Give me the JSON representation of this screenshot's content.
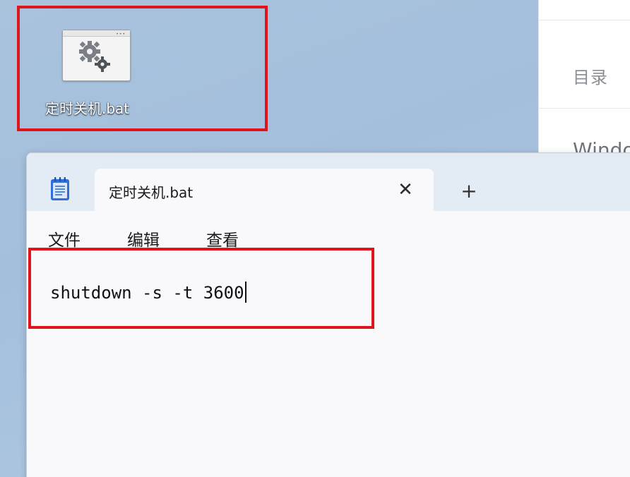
{
  "side_pane": {
    "toc_label": "目录",
    "cut_text": "Windo"
  },
  "desktop_icon": {
    "label": "定时关机.bat",
    "icon": "gears-icon"
  },
  "notepad": {
    "tab_title": "定时关机.bat",
    "tab_close_glyph": "✕",
    "tab_add_glyph": "+",
    "menu": {
      "file": "文件",
      "edit": "编辑",
      "view": "查看"
    },
    "content": "shutdown -s -t 3600"
  },
  "colors": {
    "highlight": "#e0141b",
    "desktop": "#a9c3dd",
    "tabbar": "#e3ebf4"
  }
}
